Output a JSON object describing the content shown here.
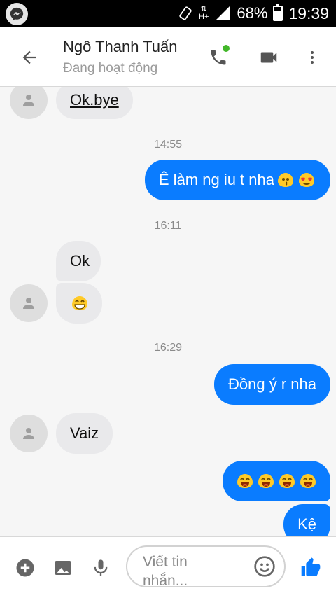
{
  "status_bar": {
    "battery_percent": "68%",
    "battery_level": 0.68,
    "time": "19:39",
    "network": "H+",
    "icons": [
      "messenger-notification-icon",
      "rotate-icon",
      "data-arrows-icon",
      "signal-icon",
      "battery-icon"
    ]
  },
  "header": {
    "contact_name": "Ngô Thanh Tuấn",
    "presence": "Đang hoạt động",
    "icons": [
      "back-arrow-icon",
      "phone-icon",
      "video-camera-icon",
      "more-vertical-icon"
    ],
    "online_color": "#42b72a"
  },
  "messages": {
    "first_in": "Ok.bye",
    "ts1": "14:55",
    "out1": "Ê làm ng iu t nha",
    "ts2": "16:11",
    "in_ok": "Ok",
    "ts3": "16:29",
    "out2": "Đồng ý r nha",
    "in_vaiz": "Vaiz",
    "out4": "Kệ",
    "emoji_names": [
      "kiss-emoji",
      "heart-eyes-emoji",
      "grin-emoji",
      "laugh-emoji"
    ]
  },
  "composer": {
    "placeholder": "Viết tin nhắn...",
    "icons": [
      "add-circle-icon",
      "image-icon",
      "microphone-icon",
      "smiley-icon",
      "thumbs-up-icon"
    ]
  },
  "colors": {
    "accent": "#0a7cff",
    "incoming_bubble": "#e9e9eb",
    "emoji_yellow": "#ffca28"
  }
}
